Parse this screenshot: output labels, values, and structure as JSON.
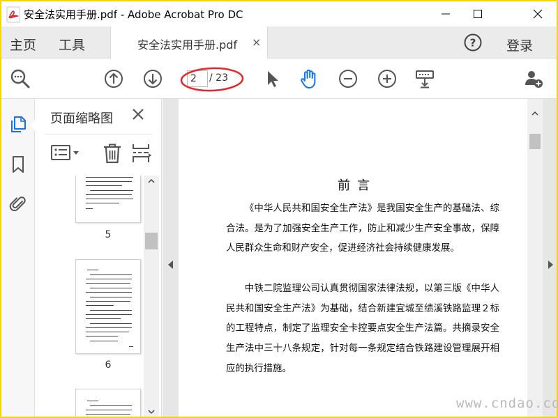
{
  "window": {
    "title": "安全法实用手册.pdf - Adobe Acrobat Pro DC",
    "minimize_glyph": "—",
    "maximize_glyph": "☐",
    "close_glyph": "✕"
  },
  "menubar": {
    "home_label": "主页",
    "tools_label": "工具",
    "document_tab_label": "安全法实用手册.pdf",
    "document_tab_close_glyph": "×",
    "help_glyph": "?",
    "login_label": "登录"
  },
  "toolbar": {
    "current_page": "2",
    "page_total": "/ 23",
    "highlight_color": "#e5262b",
    "active_tool": "hand",
    "accent_color": "#1473e6",
    "icons": [
      "search-zoom-icon",
      "prev-page-icon",
      "next-page-icon",
      "select-cursor-icon",
      "hand-tool-icon",
      "zoom-out-icon",
      "zoom-in-icon",
      "scroll-mode-icon",
      "share-user-icon"
    ]
  },
  "sidebar": {
    "icons": [
      "page-thumbnails-icon",
      "bookmarks-icon",
      "attachments-icon"
    ],
    "active": "page-thumbnails"
  },
  "thumbnails_panel": {
    "title": "页面缩略图",
    "close_glyph": "✕",
    "tools": [
      "options-menu-icon",
      "delete-page-icon",
      "insert-page-icon"
    ],
    "pages": [
      {
        "number": "5"
      },
      {
        "number": "6"
      },
      {
        "number": ""
      }
    ]
  },
  "document": {
    "heading": "前言",
    "paragraphs": [
      "《中华人民共和国安全生产法》是我国安全生产的基础法、综合法。是为了加强安全生产工作，防止和减少生产安全事故，保障人民群众生命和财产安全，促进经济社会持续健康发展。",
      "中铁二院监理公司认真贯彻国家法律法规，以第三版《中华人民共和国安全生产法》为基础，结合新建宜城至绩溪铁路监理２标的工程特点，制定了监理安全卡控要点安全生产法篇。共摘录安全生产法中三十八条规定，针对每一条规定结合铁路建设管理展开相应的执行措施。"
    ]
  },
  "watermark": "www.cndao.com"
}
